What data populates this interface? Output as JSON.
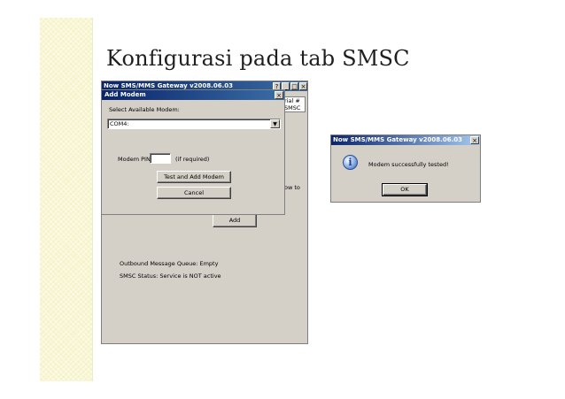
{
  "slide": {
    "title": "Konfigurasi pada tab SMSC"
  },
  "main_window": {
    "title": "Now SMS/MMS Gateway v2008.06.03",
    "btn_help": "?",
    "btn_min": "_",
    "btn_max": "□",
    "btn_close": "×",
    "col_serial_partial": "rial #",
    "col_smsc_partial": "SMSC",
    "text_partial_howto": "ow to",
    "add_label": "Add",
    "outbound_queue": "Outbound Message Queue:  Empty",
    "smsc_status": "SMSC Status:  Service is NOT active"
  },
  "add_modem_dialog": {
    "title": "Add Modem",
    "close": "×",
    "select_label": "Select Available Modem:",
    "selected_modem": "COM4:",
    "pin_label": "Modem PIN:",
    "pin_hint": "(if required)",
    "test_add_label": "Test and Add Modem",
    "cancel_label": "Cancel"
  },
  "message_box": {
    "title": "Now SMS/MMS Gateway v2008.06.03",
    "close": "×",
    "icon": "info-icon",
    "message": "Modem successfully tested!",
    "ok_label": "OK"
  }
}
